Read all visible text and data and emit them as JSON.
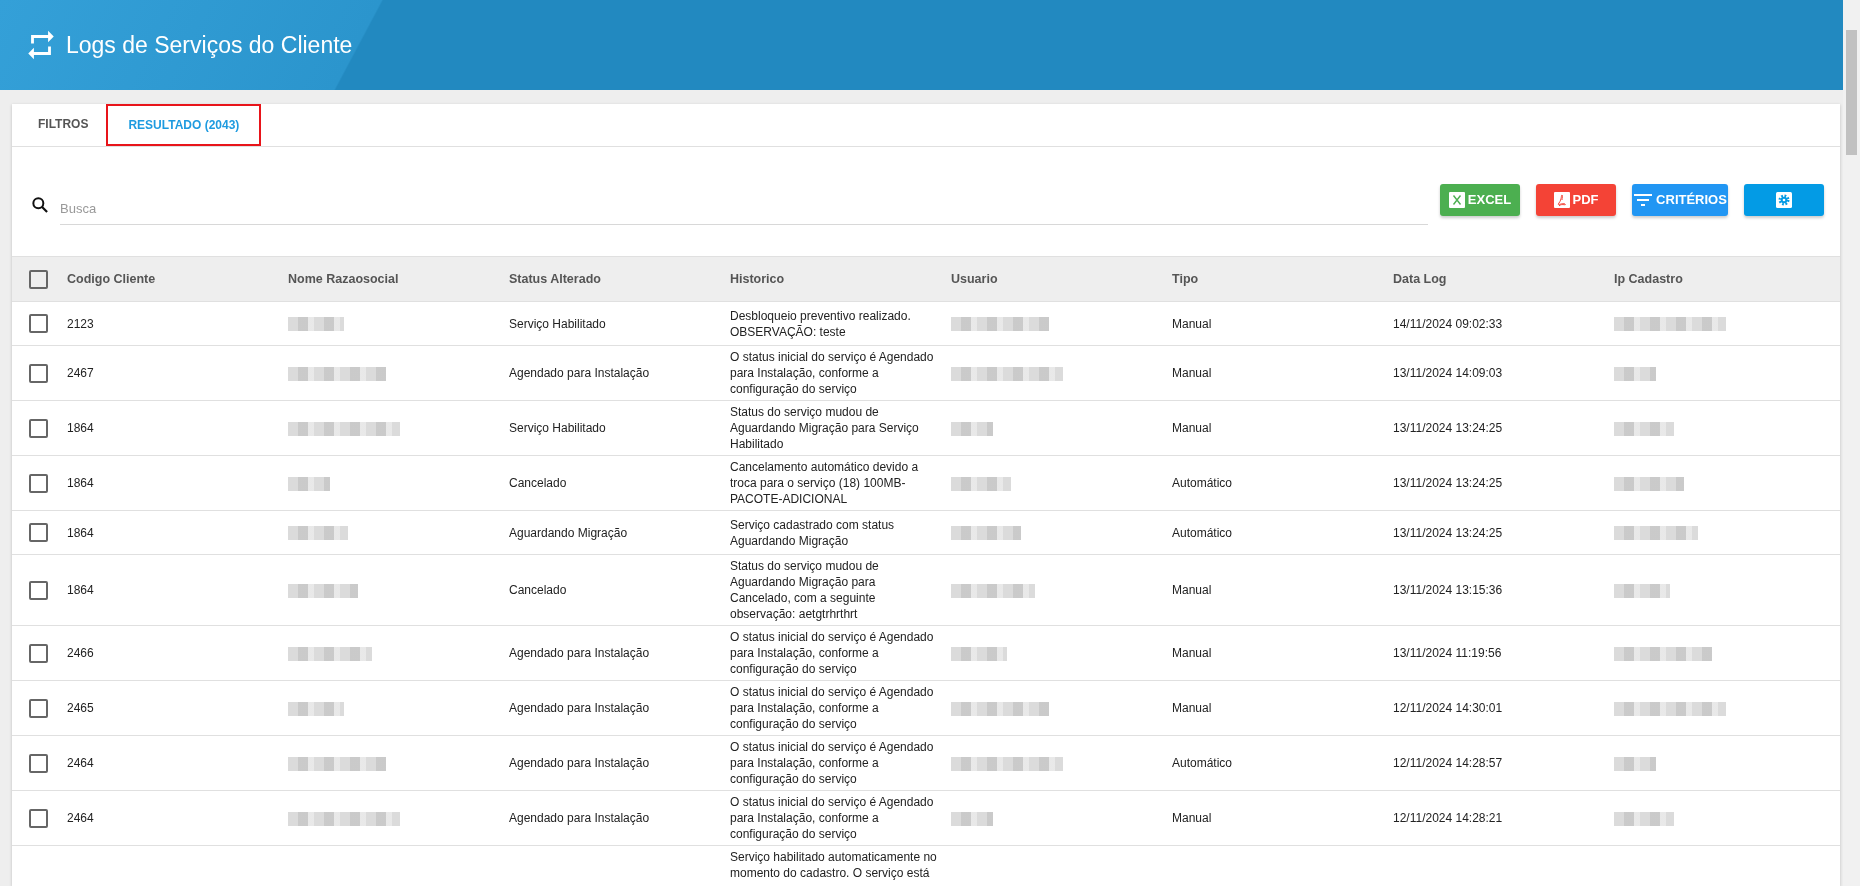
{
  "header": {
    "title": "Logs de Serviços do Cliente"
  },
  "tabs": [
    {
      "label": "FILTROS",
      "selected": false,
      "highlighted": false
    },
    {
      "label": "RESULTADO (2043)",
      "selected": true,
      "highlighted": true
    }
  ],
  "search": {
    "placeholder": "Busca"
  },
  "actions": [
    {
      "kind": "excel",
      "label": "EXCEL"
    },
    {
      "kind": "pdf",
      "label": "PDF"
    },
    {
      "kind": "criteria",
      "label": "CRITÉRIOS"
    },
    {
      "kind": "settings"
    }
  ],
  "table": {
    "select_all": {
      "checked": false
    },
    "columns": [
      "Codigo Cliente",
      "Nome Razaosocial",
      "Status Alterado",
      "Historico",
      "Usuario",
      "Tipo",
      "Data Log",
      "Ip Cadastro"
    ],
    "rows": [
      {
        "checked": false,
        "cells": [
          "2123",
          null,
          "Serviço Habilitado",
          "Desbloqueio preventivo realizado. OBSERVAÇÃO: teste",
          null,
          "Manual",
          "14/11/2024 09:02:33",
          null
        ]
      },
      {
        "checked": false,
        "cells": [
          "2467",
          null,
          "Agendado para Instalação",
          "O status inicial do serviço é Agendado para Instalação, conforme a configuração do serviço",
          null,
          "Manual",
          "13/11/2024 14:09:03",
          null
        ]
      },
      {
        "checked": false,
        "cells": [
          "1864",
          null,
          "Serviço Habilitado",
          "Status do serviço mudou de Aguardando Migração para Serviço Habilitado",
          null,
          "Manual",
          "13/11/2024 13:24:25",
          null
        ]
      },
      {
        "checked": false,
        "cells": [
          "1864",
          null,
          "Cancelado",
          "Cancelamento automático devido a troca para o serviço (18) 100MB-PACOTE-ADICIONAL",
          null,
          "Automático",
          "13/11/2024 13:24:25",
          null
        ]
      },
      {
        "checked": false,
        "cells": [
          "1864",
          null,
          "Aguardando Migração",
          "Serviço cadastrado com status Aguardando Migração",
          null,
          "Automático",
          "13/11/2024 13:24:25",
          null
        ]
      },
      {
        "checked": false,
        "cells": [
          "1864",
          null,
          "Cancelado",
          "Status do serviço mudou de Aguardando Migração para Cancelado, com a seguinte observação: aetgtrhrthrt",
          null,
          "Manual",
          "13/11/2024 13:15:36",
          null
        ]
      },
      {
        "checked": false,
        "cells": [
          "2466",
          null,
          "Agendado para Instalação",
          "O status inicial do serviço é Agendado para Instalação, conforme a configuração do serviço",
          null,
          "Manual",
          "13/11/2024 11:19:56",
          null
        ]
      },
      {
        "checked": false,
        "cells": [
          "2465",
          null,
          "Agendado para Instalação",
          "O status inicial do serviço é Agendado para Instalação, conforme a configuração do serviço",
          null,
          "Manual",
          "12/11/2024 14:30:01",
          null
        ]
      },
      {
        "checked": false,
        "cells": [
          "2464",
          null,
          "Agendado para Instalação",
          "O status inicial do serviço é Agendado para Instalação, conforme a configuração do serviço",
          null,
          "Automático",
          "12/11/2024 14:28:57",
          null
        ]
      },
      {
        "checked": false,
        "cells": [
          "2464",
          null,
          "Agendado para Instalação",
          "O status inicial do serviço é Agendado para Instalação, conforme a configuração do serviço",
          null,
          "Manual",
          "12/11/2024 14:28:21",
          null
        ]
      }
    ],
    "cut_row_historico": "Serviço habilitado automaticamente no momento do cadastro. O serviço está"
  }
}
